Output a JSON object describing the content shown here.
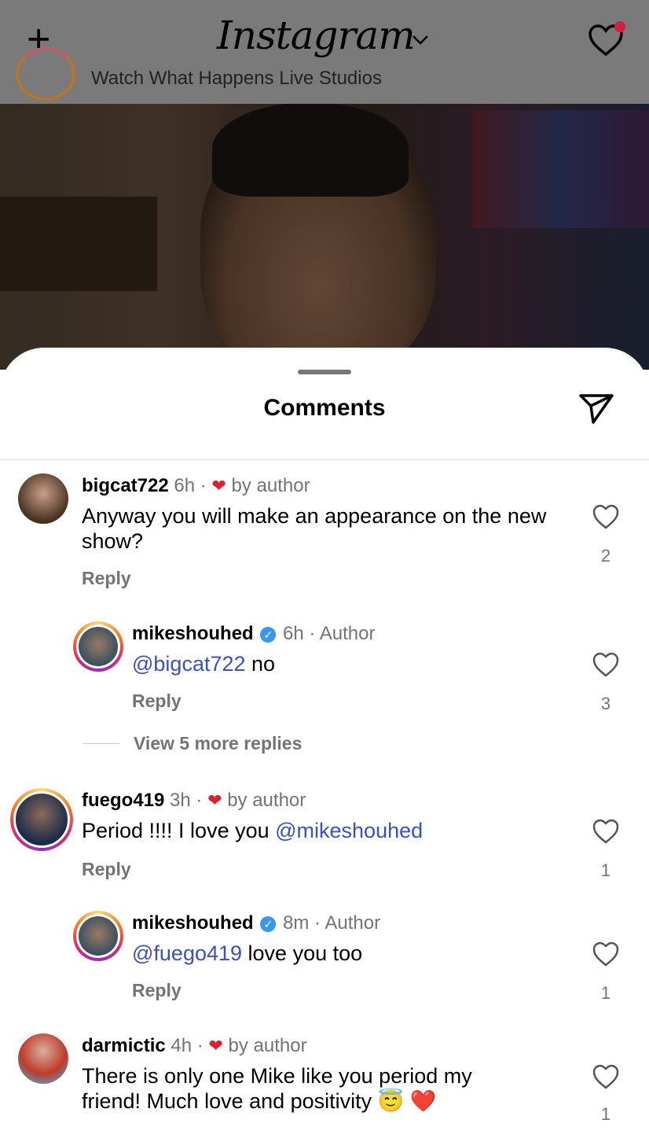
{
  "header": {
    "app_title": "Instagram",
    "post_subtitle": "Watch What Happens Live Studios"
  },
  "sheet": {
    "title": "Comments"
  },
  "comments": [
    {
      "username": "bigcat722",
      "time": "6h",
      "badge": "by author",
      "text": "Anyway you will make an appearance on the new show?",
      "reply_label": "Reply",
      "likes": "2"
    },
    {
      "username": "mikeshouhed",
      "time": "6h",
      "badge": "Author",
      "mention": "@bigcat722",
      "text": " no",
      "reply_label": "Reply",
      "likes": "3"
    },
    {
      "username": "fuego419",
      "time": "3h",
      "badge": "by author",
      "text": "Period !!!! I love you ",
      "mention": "@mikeshouhed",
      "reply_label": "Reply",
      "likes": "1"
    },
    {
      "username": "mikeshouhed",
      "time": "8m",
      "badge": "Author",
      "mention": "@fuego419",
      "text": " love you too",
      "reply_label": "Reply",
      "likes": "1"
    },
    {
      "username": "darmictic",
      "time": "4h",
      "badge": "by author",
      "text": "There is only one Mike like you period my friend! Much love and positivity 😇 ❤️",
      "likes": "1"
    }
  ],
  "view_more": "View 5 more replies",
  "colors": {
    "mention": "#3a50c8",
    "like_heart": "#e0202e",
    "verified": "#3897f0",
    "muted_text": "#737373"
  },
  "icons": [
    "plus-icon",
    "chevron-down-icon",
    "heart-icon",
    "send-icon",
    "verified-icon",
    "like-icon"
  ]
}
